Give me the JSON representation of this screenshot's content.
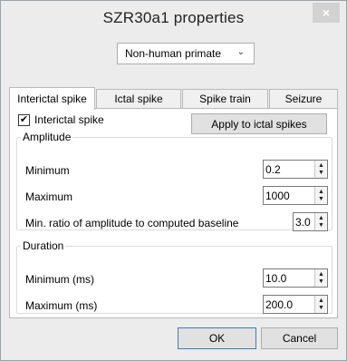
{
  "window": {
    "title": "SZR30a1 properties",
    "close_glyph": "×"
  },
  "species": {
    "selected": "Non-human primate",
    "chevron": "⌄"
  },
  "tabs": [
    {
      "label": "Interictal spike",
      "active": true
    },
    {
      "label": "Ictal spike",
      "active": false
    },
    {
      "label": "Spike train",
      "active": false
    },
    {
      "label": "Seizure",
      "active": false
    }
  ],
  "interictal": {
    "checkbox_label": "Interictal spike",
    "checkbox_checked": true,
    "check_glyph": "✔",
    "apply_label": "Apply to ictal spikes"
  },
  "amplitude": {
    "legend": "Amplitude",
    "minimum_label": "Minimum",
    "minimum_value": "0.2",
    "maximum_label": "Maximum",
    "maximum_value": "1000",
    "ratio_label": "Min. ratio of amplitude to computed baseline",
    "ratio_value": "3.0"
  },
  "duration": {
    "legend": "Duration",
    "minimum_label": "Minimum (ms)",
    "minimum_value": "10.0",
    "maximum_label": "Maximum (ms)",
    "maximum_value": "200.0"
  },
  "spin_glyphs": {
    "up": "▲",
    "down": "▼"
  },
  "footer": {
    "ok_label": "OK",
    "cancel_label": "Cancel"
  },
  "colors": {
    "window_bg": "#ececec",
    "panel_bg": "#ffffff",
    "default_button_border": "#3c7fb1"
  }
}
